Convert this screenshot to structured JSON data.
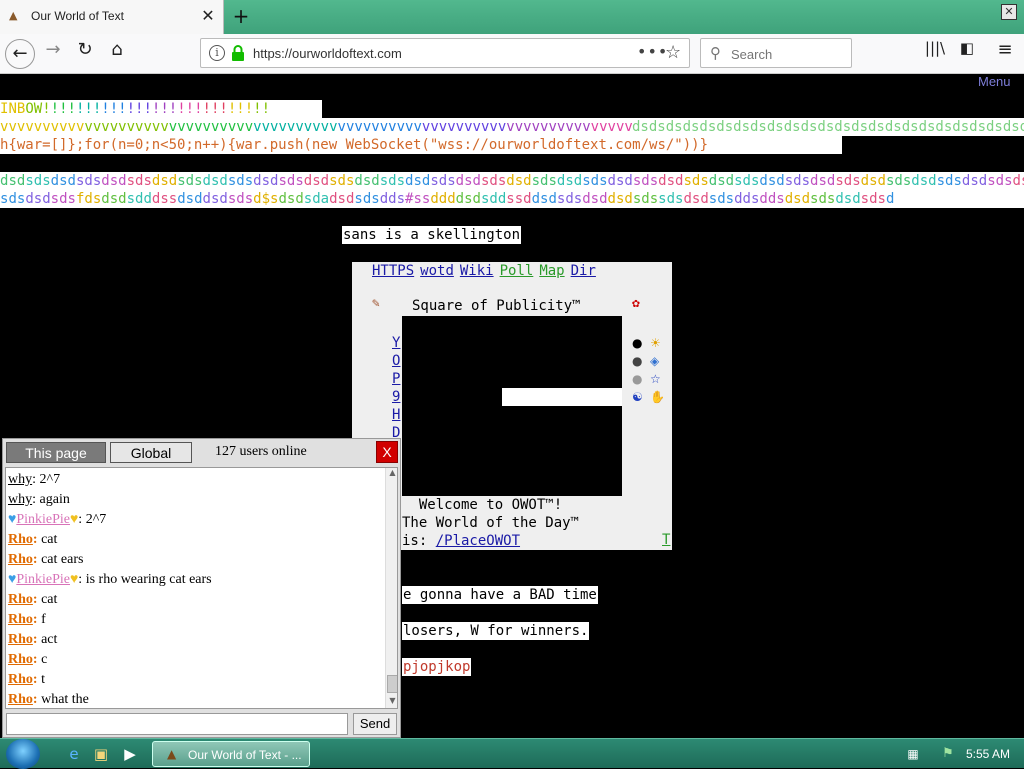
{
  "browser": {
    "tab_title": "Our World of Text",
    "tab_close": "✕",
    "new_tab": "+",
    "url": "https://ourworldoftext.com",
    "search_placeholder": "Search",
    "page_actions": "•••",
    "win_close": "✕"
  },
  "icons": {
    "back": "back-arrow-icon",
    "forward": "forward-arrow-icon",
    "reload": "reload-icon",
    "home": "home-icon",
    "info": "info-icon",
    "lock": "lock-icon",
    "star": "bookmark-star-icon",
    "search": "search-icon",
    "library": "library-icon",
    "sidebar": "sidebar-icon",
    "menu": "hamburger-menu-icon"
  },
  "owot": {
    "menu_label": "Menu",
    "row_rainbow": "INBOW!!!!!!!!!!!!!!!!!!!!!!!!!!!",
    "row_vvv_v": "vvvvvvvvvvvvvvvvvvvvvvvvvvvvvvvvvvvvvvvvvvvvvvvvvvvvvvvvvvvvvvvvvvvvvvvvvvvvvvvvvvvvvvvvvvvvvvvvvvvvvvvvvvvvvvvvvvvvvvvv",
    "row_vvv_ds": "dsdsdsdsdsdsdsdsdsdsdsdsdsdsdsdsdsdsdsdsdsdsdsdsdsds",
    "row_code": "h{war=[]};for(n=0;n<50;n++){war.push(new WebSocket(\"wss://ourworldoftext.com/ws/\"))}",
    "row_ds1": "dsdsdsdsdsdsdsdsdsdsdsdsdsdsdsdsdsdsdsdsdsdsdsdsdsdsdsdsdsdsdsdsdsdsdsdsdsdsdsdsdsdsdsdsdsdsdsdsdsdsdsdsdsdsdsdsdsdsdsdsdsds",
    "row_ds2": "sdsdsdsdsfdsdsdsdddssdsddsdsdsd$sdsdsdadsdsdsdds#ssddddsdsddssddsdsdsdsddsdsdssdsdsdsdsddsddsdsdsdsdsdsdsd",
    "sans_label": "sans is a skellington",
    "center_links": [
      "HTTPS",
      "wotd",
      "Wiki",
      "Poll",
      "Map",
      "Dir"
    ],
    "square_title": "Square of Publicity™",
    "side_links": [
      "Y",
      "O",
      "P",
      "9",
      "H",
      "D"
    ],
    "right_icons": [
      "●",
      "☀",
      "●",
      "◈",
      "●",
      "☆",
      "☯",
      "✋"
    ],
    "welcome_line1": "  Welcome to OWOT™!",
    "welcome_line2": "The World of the Day™",
    "welcome_line3_prefix": "is: ",
    "wotd_link": "/PlaceOWOT",
    "t_link": "T",
    "bad_time": "e gonna have a BAD time",
    "losers": " losers, W for winners.",
    "pjop": "pjopjkop"
  },
  "colors": {
    "rainbow": [
      "#e0c000",
      "#80c000",
      "#20c040",
      "#00b0a0",
      "#2080e0",
      "#6040e0",
      "#a040c0",
      "#e040a0",
      "#e04060"
    ],
    "code": "#d2692a",
    "rho": "#e06a00",
    "pinkie": "#d873b8"
  },
  "chat": {
    "tab_page": "This page",
    "tab_global": "Global",
    "users_online": "127 users online",
    "close": "X",
    "send": "Send",
    "messages": [
      {
        "nick": "why",
        "type": "plain",
        "text": " 2^7"
      },
      {
        "nick": "why",
        "type": "plain",
        "text": " again"
      },
      {
        "nick": "PinkiePie",
        "type": "pinkie",
        "text": " 2^7"
      },
      {
        "nick": "Rho",
        "type": "rho",
        "text": " cat"
      },
      {
        "nick": "Rho",
        "type": "rho",
        "text": " cat ears"
      },
      {
        "nick": "PinkiePie",
        "type": "pinkie",
        "text": " is rho wearing cat ears"
      },
      {
        "nick": "Rho",
        "type": "rho",
        "text": " cat"
      },
      {
        "nick": "Rho",
        "type": "rho",
        "text": " f"
      },
      {
        "nick": "Rho",
        "type": "rho",
        "text": " act"
      },
      {
        "nick": "Rho",
        "type": "rho",
        "text": " c"
      },
      {
        "nick": "Rho",
        "type": "rho",
        "text": " t"
      },
      {
        "nick": "Rho",
        "type": "rho",
        "text": " what the"
      }
    ]
  },
  "taskbar": {
    "task_label": "Our World of Text - ...",
    "clock": "5:55 AM"
  }
}
